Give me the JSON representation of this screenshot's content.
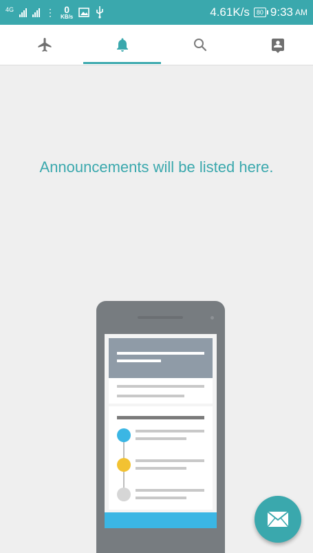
{
  "status_bar": {
    "network_type": "4G",
    "data_rate_value": "0",
    "data_rate_unit": "KB/s",
    "network_speed": "4.61K/s",
    "battery_level": "80",
    "time": "9:33",
    "ampm": "AM"
  },
  "tabs": [
    {
      "name": "flights",
      "icon": "airplane-icon",
      "selected": false
    },
    {
      "name": "announcements",
      "icon": "bell-icon",
      "selected": true
    },
    {
      "name": "search",
      "icon": "search-icon",
      "selected": false
    },
    {
      "name": "contacts",
      "icon": "contact-card-icon",
      "selected": false
    }
  ],
  "main": {
    "empty_message": "Announcements will be listed here."
  },
  "fab": {
    "icon": "mail-icon"
  },
  "colors": {
    "accent": "#3aa8ad",
    "background": "#efefef",
    "icon_gray": "#7a7a7a"
  }
}
